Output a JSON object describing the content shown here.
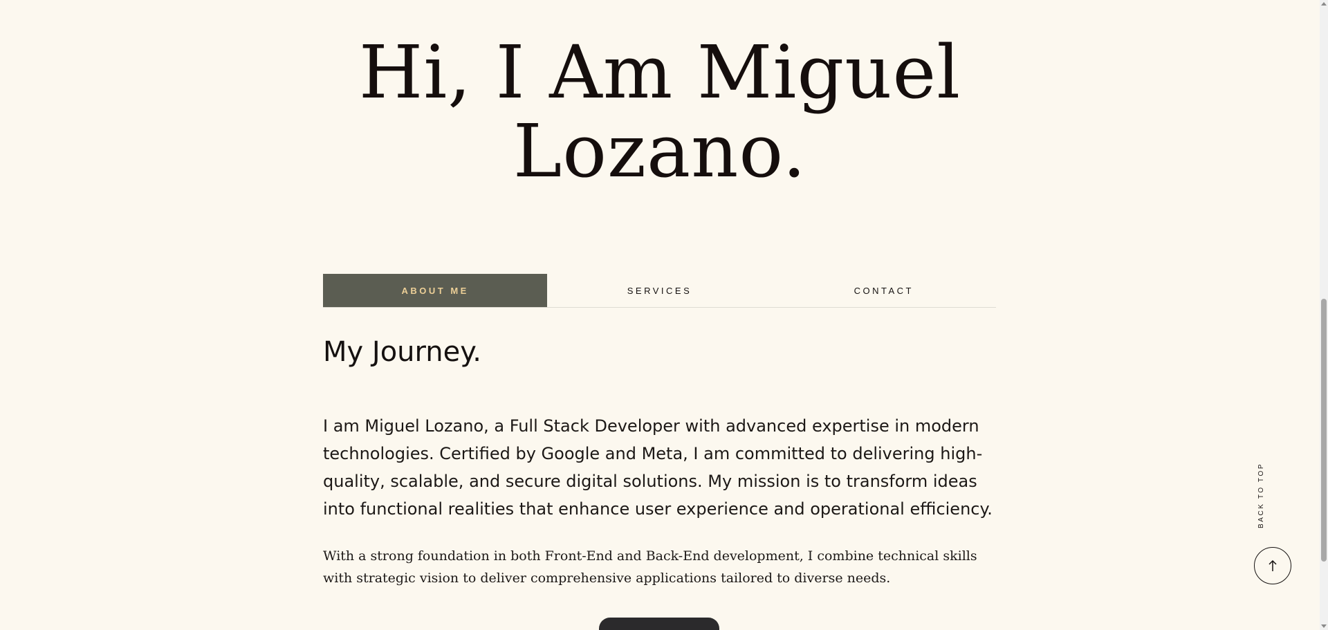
{
  "hero": {
    "line1": "Hi, I Am Miguel",
    "line2": "Lozano."
  },
  "tabs": [
    {
      "label": "ABOUT ME",
      "active": true
    },
    {
      "label": "SERVICES",
      "active": false
    },
    {
      "label": "CONTACT",
      "active": false
    }
  ],
  "about": {
    "title": "My Journey.",
    "lead": "I am Miguel Lozano, a Full Stack Developer with advanced expertise in modern technologies. Certified by Google and Meta, I am committed to delivering high-quality, scalable, and secure digital solutions. My mission is to transform ideas into functional realities that enhance user experience and operational efficiency.",
    "body": "With a strong foundation in both Front-End and Back-End development, I combine technical skills with strategic vision to deliver comprehensive applications tailored to diverse needs."
  },
  "back_to_top": {
    "label": "BACK TO TOP",
    "icon": "arrow-up-icon"
  },
  "dock": {
    "icon": "toolbar-dock"
  },
  "colors": {
    "background": "#fcf8ef",
    "text": "#151110",
    "tab_active_bg": "#5b5d52",
    "tab_active_text": "#eccf97"
  }
}
